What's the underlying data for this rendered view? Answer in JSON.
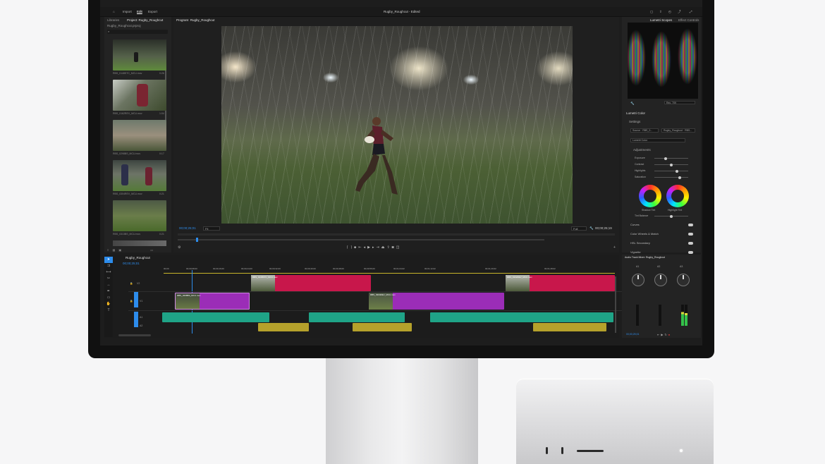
{
  "window": {
    "title": "Rugby_Roughcut - Edited"
  },
  "topnav": {
    "import": "Import",
    "edit": "Edit",
    "export": "Export"
  },
  "left_panel": {
    "tabs": [
      "Libraries",
      "Project: Rugby_Roughcut"
    ],
    "project_file": "Rugby_Roughcut.prproj",
    "clips": [
      {
        "name": "RBS_0148STC_MCU.mov",
        "duration": "0:26"
      },
      {
        "name": "RBS_0162REV_MCU.mov",
        "duration": "1:04"
      },
      {
        "name": "RBS_0298BS_MCU.mov",
        "duration": "0:17"
      },
      {
        "name": "RBS_0304REV_MCU.mov",
        "duration": "0:21"
      },
      {
        "name": "RBS_0313BS_MCU.mov",
        "duration": "0:21"
      }
    ]
  },
  "program_monitor": {
    "tab": "Program: Rugby_Roughcut",
    "timecode_current": "00;00;25;01",
    "fit": "Fit",
    "quality": "Full",
    "timecode_duration": "00;00;25;19"
  },
  "right_panel": {
    "top_tabs": [
      "Lumetri Scopes",
      "Effect Controls"
    ],
    "scope_mode": "Rec. 709",
    "lumetri": {
      "title": "Lumetri Color",
      "settings": "Settings",
      "source": "Source · RBS_0...",
      "target": "Rugby_Roughcut · RBS...",
      "preset": "Lumetri Color",
      "section": "Adjustments",
      "sliders": [
        "Exposure",
        "Contrast",
        "Highlights",
        "Saturation"
      ],
      "wheels": [
        "Shadow Tint",
        "Highlight Tint"
      ],
      "tint_balance": "Tint Balance",
      "groups": [
        "Curves",
        "Color Wheels & Match",
        "HSL Secondary",
        "Vignette"
      ]
    },
    "mixer": {
      "title": "Audio Track Mixer: Rugby_Roughcut",
      "channels": [
        "A1",
        "A2",
        "A3"
      ],
      "readout": "00;00;25;01"
    }
  },
  "timeline": {
    "title": "Rugby_Roughcut",
    "timecode": "00;00;25;01",
    "tracks": [
      "V2",
      "V1",
      "A1",
      "A2"
    ],
    "ruler": [
      "00;00",
      "00;00;08;00",
      "00;00;16;00",
      "00;00;24;00",
      "00;00;32;00",
      "00;00;40;00",
      "00;00;48;00",
      "00;00;56;00",
      "00;01;04;02",
      "00;01;12;02",
      "00;01;20;02",
      "00;01;28;02"
    ],
    "clips": {
      "v2a": "RBS_0148STC_MCU.mov",
      "v2b": "RBS_0162REV_MCU.mov",
      "v1a": "RBS_0298BS_MCU.mov",
      "v1b": "RBS_0304REV_MCU.mov"
    }
  },
  "colors": {
    "v2": "#c8174b",
    "v1": "#9b2db7",
    "a1": "#1fa487",
    "a2": "#b5a12b",
    "accent": "#2d8ceb"
  }
}
